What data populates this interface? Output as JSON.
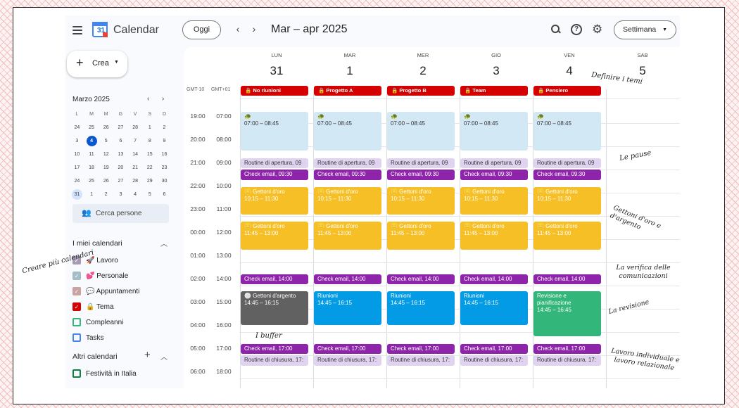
{
  "app": {
    "title": "Calendar",
    "logo_text": "31"
  },
  "toolbar": {
    "today": "Oggi",
    "prev": "‹",
    "next": "›",
    "date_range": "Mar – apr 2025",
    "view": "Settimana"
  },
  "sidebar": {
    "create": "Crea",
    "mini_month": "Marzo 2025",
    "weekdays": [
      "L",
      "M",
      "M",
      "G",
      "V",
      "S",
      "D"
    ],
    "weeks": [
      [
        "24",
        "25",
        "26",
        "27",
        "28",
        "1",
        "2"
      ],
      [
        "3",
        "4",
        "5",
        "6",
        "7",
        "8",
        "9"
      ],
      [
        "10",
        "11",
        "12",
        "13",
        "14",
        "15",
        "16"
      ],
      [
        "17",
        "18",
        "19",
        "20",
        "21",
        "22",
        "23"
      ],
      [
        "24",
        "25",
        "26",
        "27",
        "28",
        "29",
        "30"
      ],
      [
        "31",
        "1",
        "2",
        "3",
        "4",
        "5",
        "6"
      ]
    ],
    "search_people": "Cerca persone",
    "my_calendars_title": "I miei calendari",
    "my_calendars": [
      {
        "label": "🚀 Lavoro",
        "color": "#a79bb4",
        "checked": true
      },
      {
        "label": "💕 Personale",
        "color": "#a4bdc9",
        "checked": true
      },
      {
        "label": "💬 Appuntamenti",
        "color": "#c9a3a3",
        "checked": true
      },
      {
        "label": "🔒 Tema",
        "color": "#d50000",
        "checked": true
      },
      {
        "label": "Compleanni",
        "color": "#33b679",
        "checked": false
      },
      {
        "label": "Tasks",
        "color": "#4285f4",
        "checked": false
      }
    ],
    "other_calendars_title": "Altri calendari",
    "other_calendars": [
      {
        "label": "Festività in Italia",
        "color": "#0b8043",
        "checked": false
      }
    ]
  },
  "grid": {
    "timezones": [
      "GMT-10",
      "GMT+01"
    ],
    "days": [
      {
        "name": "LUN",
        "num": "31"
      },
      {
        "name": "MAR",
        "num": "1"
      },
      {
        "name": "MER",
        "num": "2"
      },
      {
        "name": "GIO",
        "num": "3"
      },
      {
        "name": "VEN",
        "num": "4"
      },
      {
        "name": "SAB",
        "num": "5"
      }
    ],
    "all_day": [
      "🔒 No riunioni",
      "🔒 Progetto A",
      "🔒 Progetto B",
      "🔒 Team",
      "🔒 Pensiero"
    ],
    "times": [
      [
        "19:00",
        "07:00"
      ],
      [
        "20:00",
        "08:00"
      ],
      [
        "21:00",
        "09:00"
      ],
      [
        "22:00",
        "10:00"
      ],
      [
        "23:00",
        "11:00"
      ],
      [
        "00:00",
        "12:00"
      ],
      [
        "01:00",
        "13:00"
      ],
      [
        "02:00",
        "14:00"
      ],
      [
        "03:00",
        "15:00"
      ],
      [
        "04:00",
        "16:00"
      ],
      [
        "05:00",
        "17:00"
      ],
      [
        "06:00",
        "18:00"
      ]
    ],
    "event_text": {
      "morning": "07:00 – 08:45",
      "morning_icon": "🐢",
      "routine_open": "Routine di apertura, 09",
      "check_930": "Check email, 09:30",
      "gettoni": "🪙 Gettoni d'oro",
      "g1_time": "10:15 – 11:30",
      "g2_time": "11:45 – 13:00",
      "check_14": "Check email, 14:00",
      "argento": "⚪ Gettoni d'argento",
      "riunioni": "Riunioni",
      "afternoon_time": "14:45 – 16:15",
      "revisione": "Revisione e pianificazione",
      "revisione_time": "14:45 – 16:45",
      "check_17": "Check email, 17:00",
      "routine_close": "Routine di chiusura, 17:"
    }
  },
  "annotations": {
    "multi_calendars": "Creare più calendari",
    "themes": "Definire i temi",
    "pauses": "Le pause",
    "gold_silver": "Gettoni d'oro e d'argento",
    "verify": "La verifica delle comunicazioni",
    "review": "La revisione",
    "buffer": "I buffer",
    "work": "Lavoro individuale e lavoro relazionale"
  },
  "colors": {
    "accent": "#0b57d0",
    "theme_red": "#d50000",
    "purple": "#8e24aa",
    "gold": "#f6bf26",
    "meeting": "#039be5",
    "review": "#33b679",
    "silver": "#616161"
  }
}
